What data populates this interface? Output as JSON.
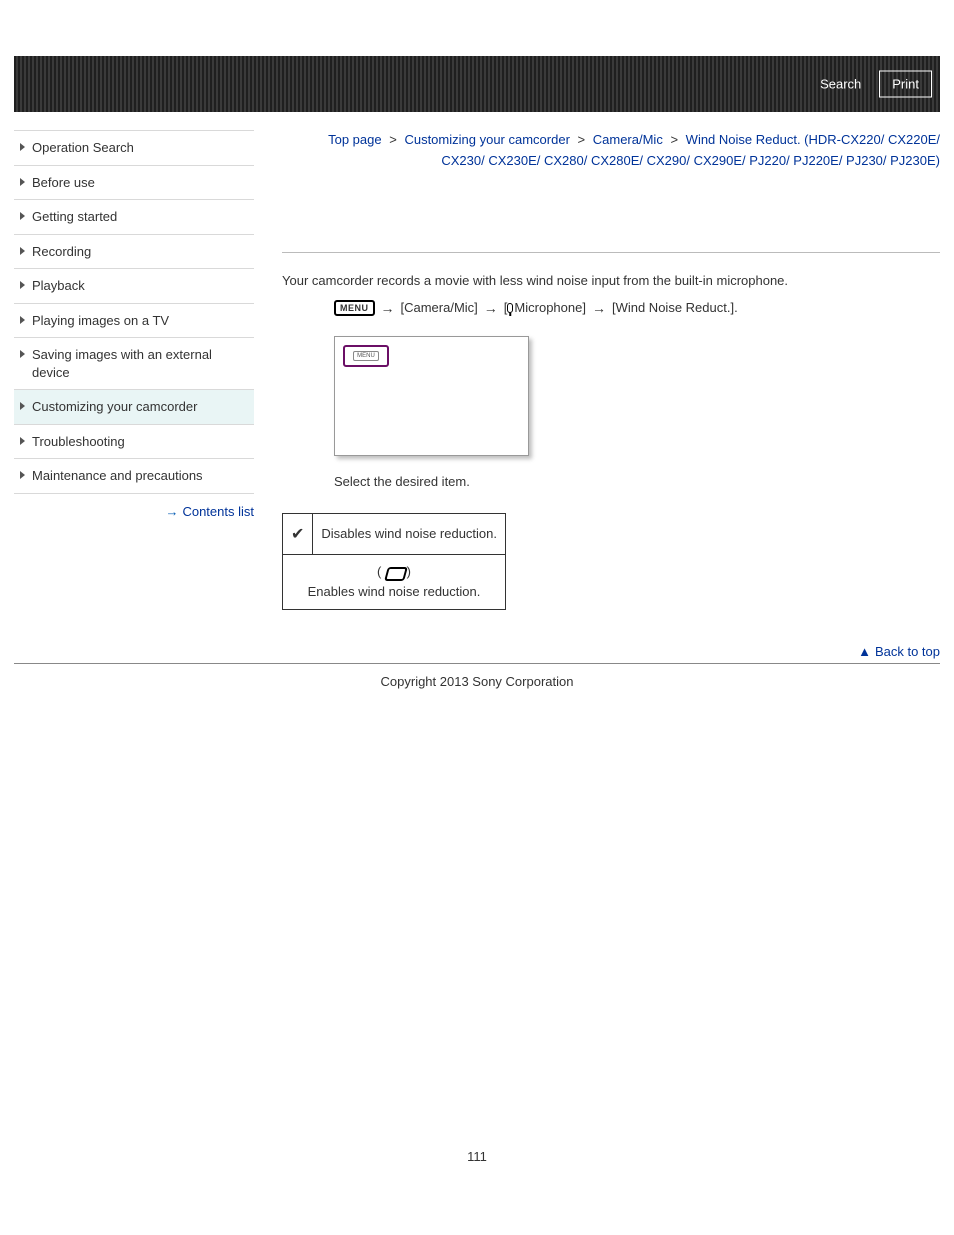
{
  "header": {
    "search_label": "Search",
    "print_label": "Print"
  },
  "sidebar": {
    "items": [
      {
        "label": "Operation Search"
      },
      {
        "label": "Before use"
      },
      {
        "label": "Getting started"
      },
      {
        "label": "Recording"
      },
      {
        "label": "Playback"
      },
      {
        "label": "Playing images on a TV"
      },
      {
        "label": "Saving images with an external device"
      },
      {
        "label": "Customizing your camcorder"
      },
      {
        "label": "Troubleshooting"
      },
      {
        "label": "Maintenance and precautions"
      }
    ],
    "active_index": 7,
    "contents_link": "Contents list"
  },
  "breadcrumb": {
    "parts": [
      "Top page",
      "Customizing your camcorder",
      "Camera/Mic"
    ],
    "current": "Wind Noise Reduct. (HDR-CX220/ CX220E/ CX230/ CX230E/ CX280/ CX280E/ CX290/ CX290E/ PJ220/ PJ220E/ PJ230/ PJ230E)"
  },
  "main": {
    "lead": "Your camcorder records a movie with less wind noise input from the built-in microphone.",
    "seq": {
      "menu_icon": "MENU",
      "step2": "[Camera/Mic]",
      "step3a": "[",
      "step3b": "Microphone]",
      "step4": "[Wind Noise Reduct.].",
      "inner_chip": "MENU"
    },
    "note": "Select the desired item.",
    "options": [
      {
        "icon": "check",
        "text": "Disables wind noise reduction."
      },
      {
        "icon": "wind",
        "text": "Enables wind noise reduction."
      }
    ],
    "back_top": "Back to top"
  },
  "footer": {
    "copyright": "Copyright 2013 Sony Corporation",
    "page_number": "111"
  }
}
